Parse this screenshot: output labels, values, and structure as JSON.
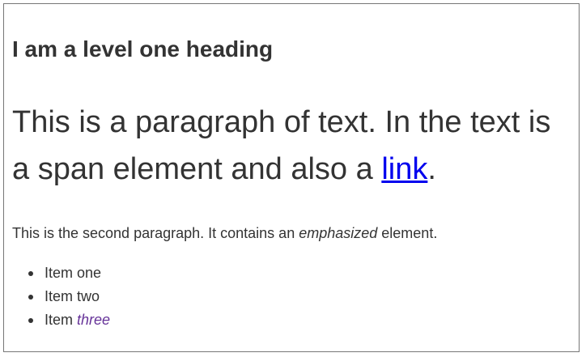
{
  "heading": "I am a level one heading",
  "paragraph1": {
    "text_before_link": "This is a paragraph of text. In the text is a span element and also a ",
    "link_text": "link",
    "text_after_link": "."
  },
  "paragraph2": {
    "text_before_em": "This is the second paragraph. It contains an ",
    "em_text": "emphasized",
    "text_after_em": " element."
  },
  "list": {
    "items": [
      {
        "text": "Item one"
      },
      {
        "text": "Item two"
      },
      {
        "text": "Item ",
        "em_text": "three"
      }
    ]
  },
  "colors": {
    "text": "#333333",
    "link": "#0000ee",
    "emphasis_list": "#663399",
    "border": "#777777"
  }
}
